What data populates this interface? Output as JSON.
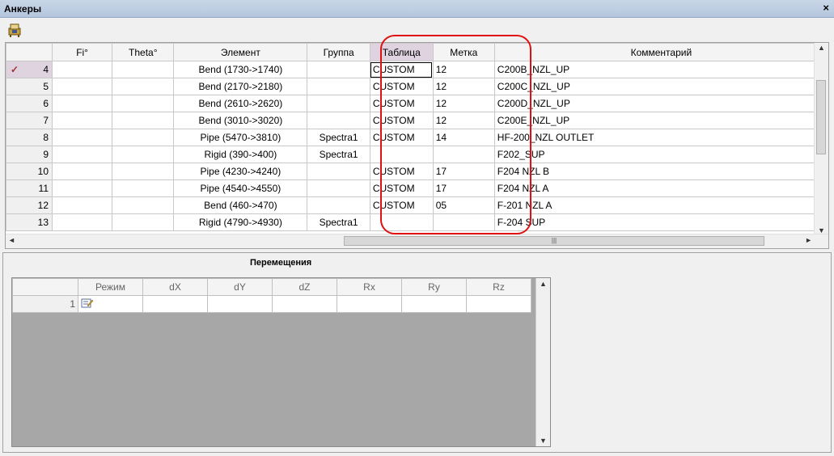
{
  "window": {
    "title": "Анкеры",
    "close_glyph": "×"
  },
  "toolbar": {
    "icon": "anchor-tool-icon"
  },
  "main_table": {
    "columns": [
      "Fi°",
      "Theta°",
      "Элемент",
      "Группа",
      "Таблица",
      "Метка",
      "Комментарий"
    ],
    "current_marker": "✓",
    "rows": [
      {
        "n": "4",
        "fi": "",
        "theta": "",
        "element": "Bend (1730->1740)",
        "group": "",
        "table": "CUSTOM",
        "label": "12",
        "comment": "C200B_NZL_UP"
      },
      {
        "n": "5",
        "fi": "",
        "theta": "",
        "element": "Bend (2170->2180)",
        "group": "",
        "table": "CUSTOM",
        "label": "12",
        "comment": "C200C_NZL_UP"
      },
      {
        "n": "6",
        "fi": "",
        "theta": "",
        "element": "Bend (2610->2620)",
        "group": "",
        "table": "CUSTOM",
        "label": "12",
        "comment": "C200D_NZL_UP"
      },
      {
        "n": "7",
        "fi": "",
        "theta": "",
        "element": "Bend (3010->3020)",
        "group": "",
        "table": "CUSTOM",
        "label": "12",
        "comment": "C200E_NZL_UP"
      },
      {
        "n": "8",
        "fi": "",
        "theta": "",
        "element": "Pipe (5470->3810)",
        "group": "Spectra1",
        "table": "CUSTOM",
        "label": "14",
        "comment": "HF-200_NZL OUTLET"
      },
      {
        "n": "9",
        "fi": "",
        "theta": "",
        "element": "Rigid (390->400)",
        "group": "Spectra1",
        "table": "",
        "label": "",
        "comment": "F202_SUP"
      },
      {
        "n": "10",
        "fi": "",
        "theta": "",
        "element": "Pipe (4230->4240)",
        "group": "",
        "table": "CUSTOM",
        "label": "17",
        "comment": "F204 NZL B"
      },
      {
        "n": "11",
        "fi": "",
        "theta": "",
        "element": "Pipe (4540->4550)",
        "group": "",
        "table": "CUSTOM",
        "label": "17",
        "comment": "F204 NZL A"
      },
      {
        "n": "12",
        "fi": "",
        "theta": "",
        "element": "Bend (460->470)",
        "group": "",
        "table": "CUSTOM",
        "label": "05",
        "comment": "F-201 NZL A"
      },
      {
        "n": "13",
        "fi": "",
        "theta": "",
        "element": "Rigid (4790->4930)",
        "group": "Spectra1",
        "table": "",
        "label": "",
        "comment": "F-204 SUP"
      }
    ]
  },
  "displacements": {
    "title": "Перемещения",
    "columns": [
      "Режим",
      "dX",
      "dY",
      "dZ",
      "Rx",
      "Ry",
      "Rz"
    ],
    "rows": [
      {
        "n": "1",
        "mode_icon": "edit-icon"
      }
    ]
  },
  "colors": {
    "highlight": "#e01010",
    "selected_header": "#e0d3e0",
    "title_bar": "#c9d6e8"
  }
}
